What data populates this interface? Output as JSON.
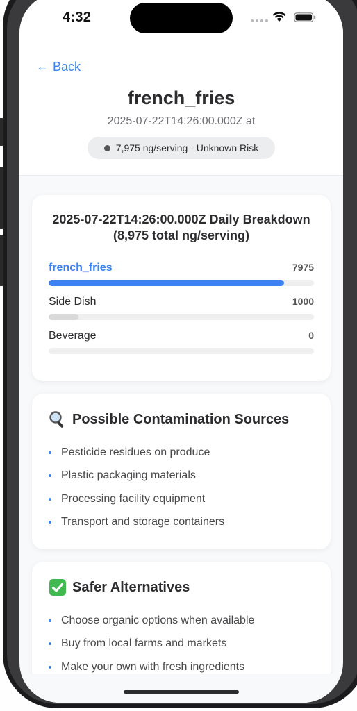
{
  "status_bar": {
    "time": "4:32"
  },
  "header": {
    "back_label": "Back",
    "title": "french_fries",
    "subtitle": "2025-07-22T14:26:00.000Z at",
    "badge_text": "7,975 ng/serving - Unknown Risk"
  },
  "breakdown": {
    "title": "2025-07-22T14:26:00.000Z Daily Breakdown (8,975 total ng/serving)",
    "items": [
      {
        "label": "french_fries",
        "value": "7975",
        "fraction": 0.8886,
        "active": true
      },
      {
        "label": "Side Dish",
        "value": "1000",
        "fraction": 0.1114,
        "active": false
      },
      {
        "label": "Beverage",
        "value": "0",
        "fraction": 0,
        "active": false
      }
    ]
  },
  "sources": {
    "title": "Possible Contamination Sources",
    "icon": "magnifier-icon",
    "items": [
      "Pesticide residues on produce",
      "Plastic packaging materials",
      "Processing facility equipment",
      "Transport and storage containers"
    ]
  },
  "alternatives": {
    "title": "Safer Alternatives",
    "icon": "check-mark-icon",
    "items": [
      "Choose organic options when available",
      "Buy from local farms and markets",
      "Make your own with fresh ingredients"
    ]
  },
  "colors": {
    "accent": "#3a83f0",
    "bar_inactive": "#d9d9d9"
  }
}
